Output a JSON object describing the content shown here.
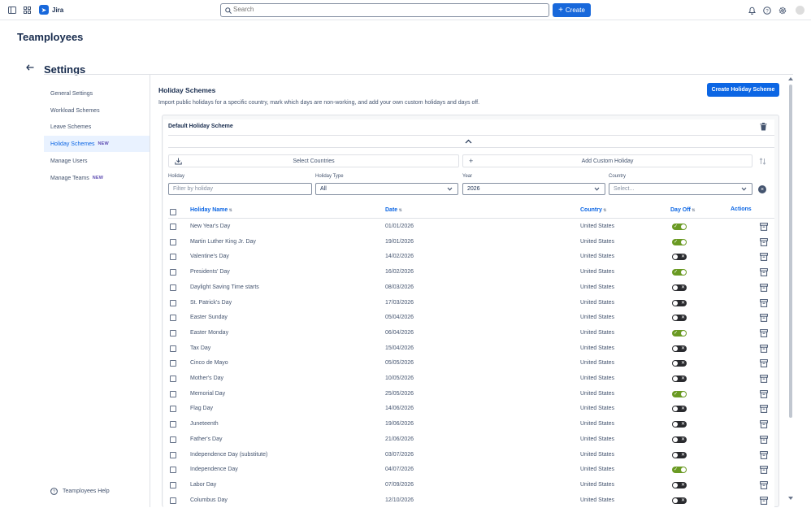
{
  "topbar": {
    "product": "Jira",
    "search_placeholder": "Search",
    "create_label": "Create"
  },
  "app_title": "Teamployees",
  "settings_title": "Settings",
  "sidebar": {
    "items": [
      {
        "label": "General Settings",
        "badge": ""
      },
      {
        "label": "Workload Schemes",
        "badge": ""
      },
      {
        "label": "Leave Schemes",
        "badge": ""
      },
      {
        "label": "Holiday Schemes",
        "badge": "NEW"
      },
      {
        "label": "Manage Users",
        "badge": ""
      },
      {
        "label": "Manage Teams",
        "badge": "NEW"
      }
    ],
    "help_label": "Teamployees Help"
  },
  "section": {
    "title": "Holiday Schemes",
    "description": "Import public holidays for a specific country, mark which days are non-working, and add your own custom holidays and days off.",
    "create_button": "Create Holiday Scheme"
  },
  "scheme": {
    "name": "Default Holiday Scheme",
    "select_countries_label": "Select Countries",
    "add_custom_label": "Add Custom Holiday"
  },
  "filters": {
    "holiday_label": "Holiday",
    "holiday_placeholder": "Filter by holiday",
    "type_label": "Holiday Type",
    "type_value": "All",
    "year_label": "Year",
    "year_value": "2026",
    "country_label": "Country",
    "country_placeholder": "Select..."
  },
  "table": {
    "headers": {
      "name": "Holiday Name",
      "date": "Date",
      "country": "Country",
      "day_off": "Day Off",
      "actions": "Actions"
    },
    "rows": [
      {
        "name": "New Year's Day",
        "date": "01/01/2026",
        "country": "United States",
        "day_off": true
      },
      {
        "name": "Martin Luther King Jr. Day",
        "date": "19/01/2026",
        "country": "United States",
        "day_off": true
      },
      {
        "name": "Valentine's Day",
        "date": "14/02/2026",
        "country": "United States",
        "day_off": false
      },
      {
        "name": "Presidents' Day",
        "date": "16/02/2026",
        "country": "United States",
        "day_off": true
      },
      {
        "name": "Daylight Saving Time starts",
        "date": "08/03/2026",
        "country": "United States",
        "day_off": false
      },
      {
        "name": "St. Patrick's Day",
        "date": "17/03/2026",
        "country": "United States",
        "day_off": false
      },
      {
        "name": "Easter Sunday",
        "date": "05/04/2026",
        "country": "United States",
        "day_off": false
      },
      {
        "name": "Easter Monday",
        "date": "06/04/2026",
        "country": "United States",
        "day_off": true
      },
      {
        "name": "Tax Day",
        "date": "15/04/2026",
        "country": "United States",
        "day_off": false
      },
      {
        "name": "Cinco de Mayo",
        "date": "05/05/2026",
        "country": "United States",
        "day_off": false
      },
      {
        "name": "Mother's Day",
        "date": "10/05/2026",
        "country": "United States",
        "day_off": false
      },
      {
        "name": "Memorial Day",
        "date": "25/05/2026",
        "country": "United States",
        "day_off": true
      },
      {
        "name": "Flag Day",
        "date": "14/06/2026",
        "country": "United States",
        "day_off": false
      },
      {
        "name": "Juneteenth",
        "date": "19/06/2026",
        "country": "United States",
        "day_off": false
      },
      {
        "name": "Father's Day",
        "date": "21/06/2026",
        "country": "United States",
        "day_off": false
      },
      {
        "name": "Independence Day (substitute)",
        "date": "03/07/2026",
        "country": "United States",
        "day_off": false
      },
      {
        "name": "Independence Day",
        "date": "04/07/2026",
        "country": "United States",
        "day_off": true
      },
      {
        "name": "Labor Day",
        "date": "07/09/2026",
        "country": "United States",
        "day_off": false
      },
      {
        "name": "Columbus Day",
        "date": "12/10/2026",
        "country": "United States",
        "day_off": false
      }
    ]
  },
  "colors": {
    "primary": "#0c66e4",
    "toggle_on": "#6a9a23",
    "toggle_off": "#292a2e"
  }
}
